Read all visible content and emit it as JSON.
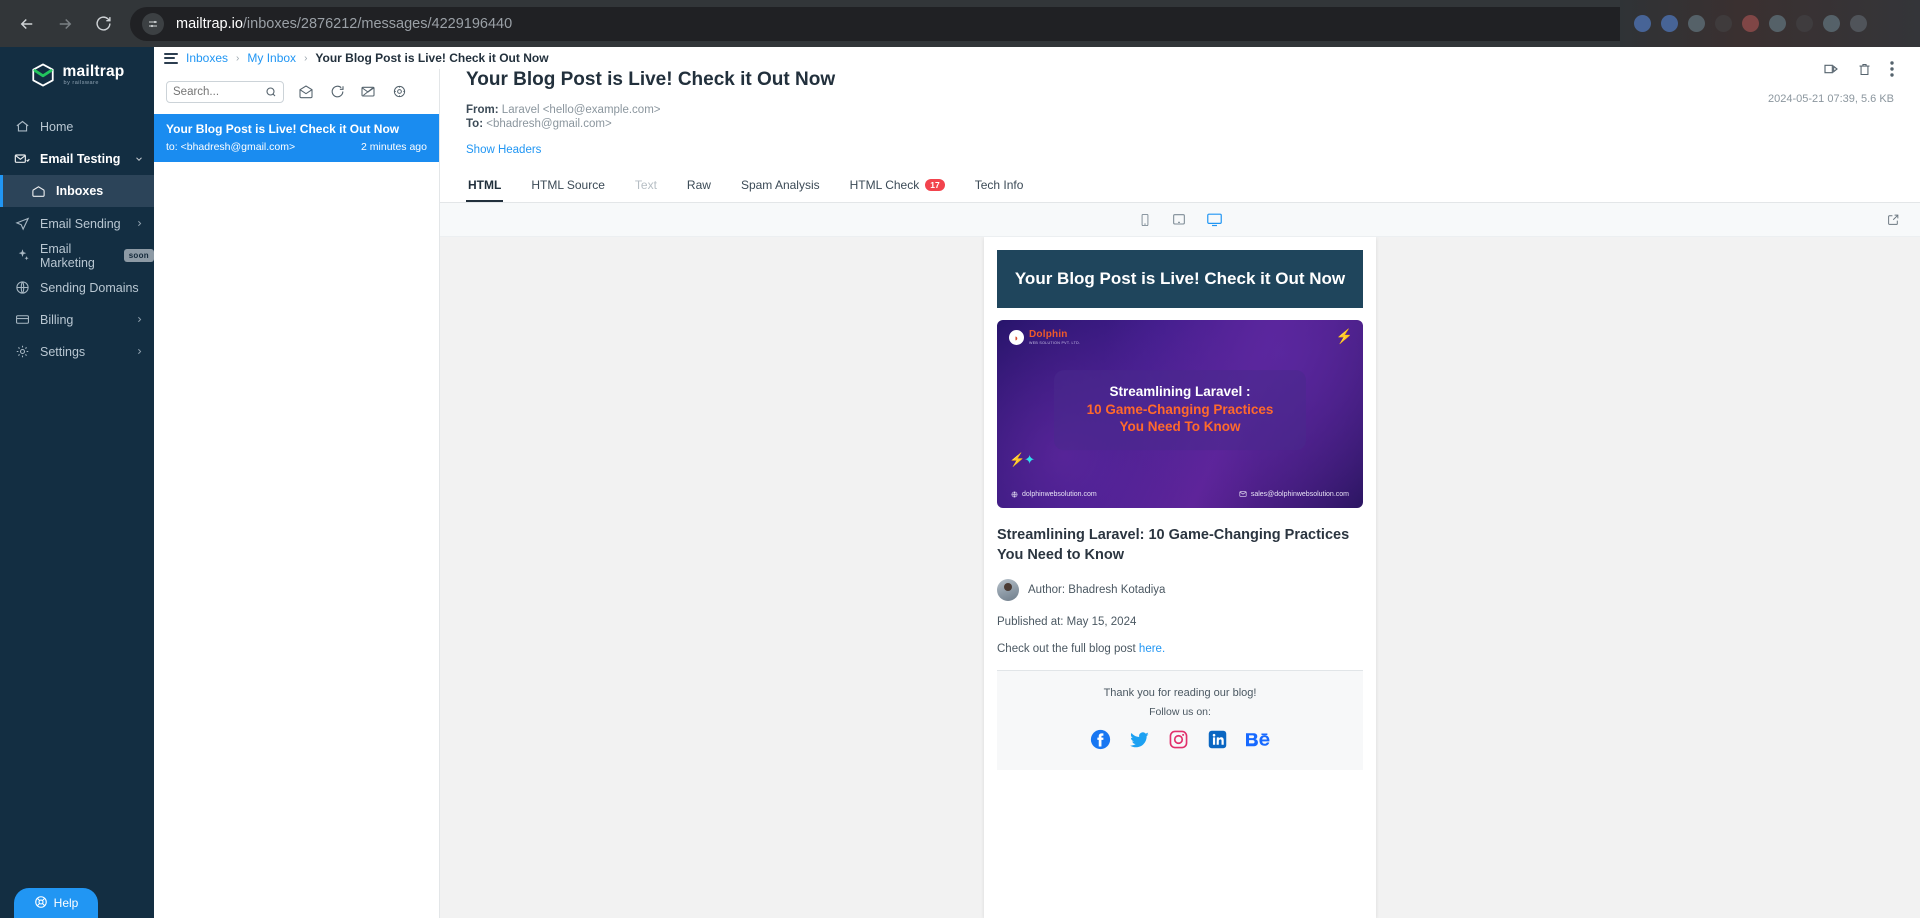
{
  "browser": {
    "url_domain": "mailtrap.io",
    "url_path": "/inboxes/2876212/messages/4229196440",
    "back_icon": "back-arrow-icon",
    "forward_icon": "forward-arrow-icon",
    "reload_icon": "reload-icon",
    "site_settings_icon": "site-settings-icon",
    "search_icon": "search-icon",
    "bookmark_icon": "star-icon"
  },
  "sidebar": {
    "logo_name": "mailtrap",
    "logo_sub": "by railsware",
    "items": [
      {
        "label": "Home",
        "icon": "home-icon",
        "type": "item"
      },
      {
        "label": "Email Testing",
        "icon": "email-testing-icon",
        "type": "parent",
        "expanded": true
      },
      {
        "label": "Inboxes",
        "icon": "inbox-icon",
        "type": "sub",
        "active": true
      },
      {
        "label": "Email Sending",
        "icon": "send-icon",
        "type": "parent"
      },
      {
        "label": "Email Marketing",
        "icon": "sparkle-icon",
        "type": "item",
        "badge": "soon"
      },
      {
        "label": "Sending Domains",
        "icon": "globe-icon",
        "type": "item"
      },
      {
        "label": "Billing",
        "icon": "card-icon",
        "type": "parent"
      },
      {
        "label": "Settings",
        "icon": "gear-icon",
        "type": "parent"
      }
    ],
    "help_label": "Help",
    "help_icon": "lifebuoy-icon"
  },
  "breadcrumb": {
    "menu_icon": "hamburger-icon",
    "items": [
      "Inboxes",
      "My Inbox"
    ],
    "current": "Your Blog Post is Live! Check it Out Now",
    "separator": "›"
  },
  "list": {
    "search_placeholder": "Search...",
    "search_value": "",
    "search_icon": "search-icon",
    "toolbar_icons": [
      "mark-as-read-icon",
      "refresh-icon",
      "clear-inbox-icon",
      "settings-icon"
    ],
    "messages": [
      {
        "subject": "Your Blog Post is Live! Check it Out Now",
        "to": "to: <bhadresh@gmail.com>",
        "time": "2 minutes ago",
        "selected": true
      }
    ]
  },
  "detail": {
    "title": "Your Blog Post is Live! Check it Out Now",
    "from_label": "From:",
    "from_value": "Laravel <hello@example.com>",
    "to_label": "To:",
    "to_value": "<bhadresh@gmail.com>",
    "show_headers": "Show Headers",
    "meta": "2024-05-21 07:39, 5.6 KB",
    "actions": [
      "forward-icon",
      "delete-icon",
      "more-options-icon"
    ],
    "tabs": [
      {
        "label": "HTML",
        "active": true
      },
      {
        "label": "HTML Source"
      },
      {
        "label": "Text",
        "disabled": true
      },
      {
        "label": "Raw"
      },
      {
        "label": "Spam Analysis"
      },
      {
        "label": "HTML Check",
        "badge": "17"
      },
      {
        "label": "Tech Info"
      }
    ],
    "viewport_icons": [
      "mobile-view-icon",
      "tablet-view-icon",
      "desktop-view-icon"
    ],
    "selected_viewport": "desktop-view-icon",
    "open_external_icon": "open-in-new-icon"
  },
  "email": {
    "banner_title": "Your Blog Post is Live! Check it Out Now",
    "banner_color": "#1f455c",
    "hero": {
      "brand": "Dolphin",
      "brand_sub": "WEB SOLUTION PVT. LTD.",
      "line1": "Streamlining Laravel :",
      "line2": "10 Game-Changing Practices",
      "line3": "You Need To Know",
      "line2_color": "#ff6a2b",
      "website": "dolphinwebsolution.com",
      "email": "sales@dolphinwebsolution.com",
      "globe_icon": "globe-icon",
      "mail_icon": "mail-icon",
      "bolt_icon": "bolt-icon"
    },
    "article_title": "Streamlining Laravel: 10 Game-Changing Practices You Need to Know",
    "author": "Author: Bhadresh Kotadiya",
    "published": "Published at: May 15, 2024",
    "cta_text": "Check out the full blog post ",
    "cta_link": "here.",
    "footer_thanks": "Thank you for reading our blog!",
    "footer_follow": "Follow us on:",
    "socials": [
      {
        "name": "facebook-icon",
        "color": "#1877F2"
      },
      {
        "name": "twitter-icon",
        "color": "#1DA1F2"
      },
      {
        "name": "instagram-icon",
        "color": "#E1306C"
      },
      {
        "name": "linkedin-icon",
        "color": "#0A66C2"
      },
      {
        "name": "behance-icon",
        "color": "#1769FF"
      }
    ]
  }
}
